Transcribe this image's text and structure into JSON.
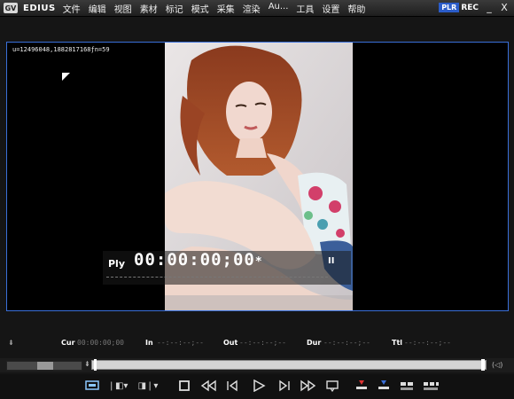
{
  "app": {
    "name": "EDIUS",
    "logo": "GV"
  },
  "menu": [
    "文件",
    "编辑",
    "视图",
    "素材",
    "标记",
    "模式",
    "采集",
    "渲染",
    "Au...",
    "工具",
    "设置",
    "帮助"
  ],
  "mode": {
    "plr": "PLR",
    "rec": "REC"
  },
  "window": {
    "minimize": "_",
    "close": "X"
  },
  "viewer": {
    "coordinates": "u=12496048,1882817168ƒn=59",
    "playback_mode": "Ply",
    "timecode": "00:00:00;00",
    "timecode_flag": "*",
    "pause_symbol": "II"
  },
  "info": {
    "cur_label": "Cur",
    "cur_value": "00:00:00;00",
    "in_label": "In",
    "in_value": "--:--:--;--",
    "out_label": "Out",
    "out_value": "--:--:--;--",
    "dur_label": "Dur",
    "dur_value": "--:--:--;--",
    "ttl_label": "Ttl",
    "ttl_value": "--:--:--;--"
  },
  "colors": {
    "viewer_border": "#3a6fd8",
    "plr_badge": "#2b5cc8",
    "mark_red": "#d33"
  },
  "icons": [
    "clip-monitor-icon",
    "mark-in-icon",
    "mark-out-icon",
    "stop-icon",
    "rewind-icon",
    "step-back-icon",
    "play-icon",
    "step-forward-icon",
    "fast-forward-icon",
    "loop-icon",
    "insert-to-timeline-icon",
    "overwrite-to-timeline-icon",
    "export-icon",
    "more-icon"
  ]
}
